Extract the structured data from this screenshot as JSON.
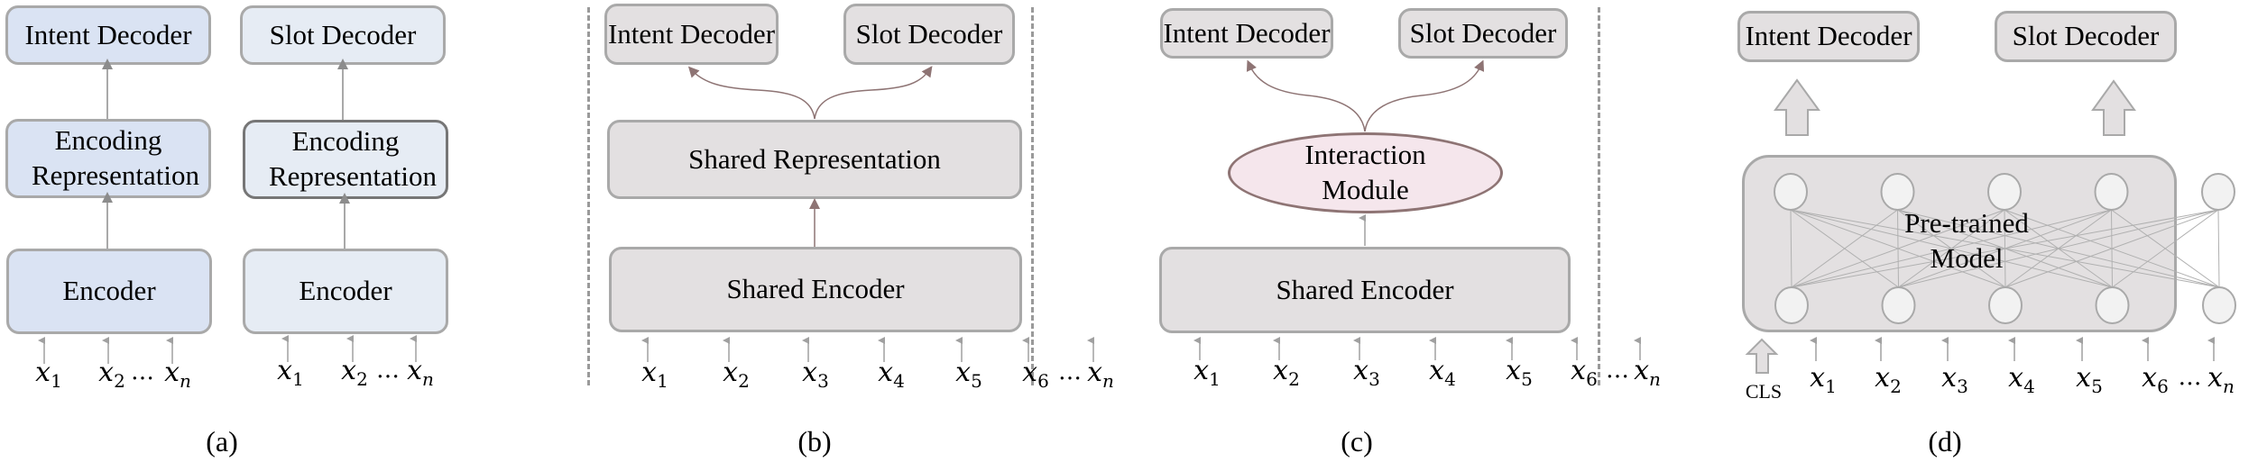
{
  "figure": {
    "panels": [
      {
        "caption": "(a)",
        "left": {
          "decoder": "Intent Decoder",
          "representation": "Encoding Representation",
          "encoder": "Encoder",
          "tokens": [
            "x1",
            "x2",
            "xn"
          ]
        },
        "right": {
          "decoder": "Slot Decoder",
          "representation": "Encoding Representation",
          "encoder": "Encoder",
          "tokens": [
            "x1",
            "x2",
            "xn"
          ]
        }
      },
      {
        "caption": "(b)",
        "intent_decoder": "Intent Decoder",
        "slot_decoder": "Slot Decoder",
        "shared_representation": "Shared Representation",
        "shared_encoder": "Shared Encoder",
        "tokens": [
          "x1",
          "x2",
          "x3",
          "x4",
          "x5",
          "x6",
          "xn"
        ]
      },
      {
        "caption": "(c)",
        "intent_decoder": "Intent Decoder",
        "slot_decoder": "Slot Decoder",
        "interaction_module": "Interaction Module",
        "shared_encoder": "Shared Encoder",
        "tokens": [
          "x1",
          "x2",
          "x3",
          "x4",
          "x5",
          "x6",
          "xn"
        ]
      },
      {
        "caption": "(d)",
        "intent_decoder": "Intent Decoder",
        "slot_decoder": "Slot Decoder",
        "pretrained_model": "Pre-trained Model",
        "cls_label": "CLS",
        "node_count": 5,
        "tokens": [
          "x1",
          "x2",
          "x3",
          "x4",
          "x5",
          "x6",
          "xn"
        ]
      }
    ],
    "ellipsis": "…",
    "colors": {
      "blue_fill": "#dae3f3",
      "light_blue_fill": "#e6ecf4",
      "grey_fill": "#e3e0e1",
      "pink_fill": "#f5e6ec",
      "arrow_grey": "#a0a0a0",
      "arrow_brown": "#8e7474"
    }
  }
}
